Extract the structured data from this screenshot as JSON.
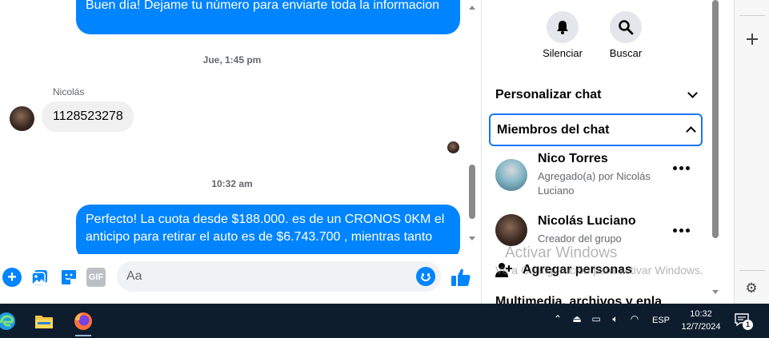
{
  "chat": {
    "messages": [
      {
        "text": "Buen día! Dejame tu número para enviarte toda la informacion",
        "direction": "outgoing"
      },
      {
        "sender": "Nicolás",
        "text": "1128523278",
        "direction": "incoming"
      },
      {
        "text": "Perfecto! La cuota desde $188.000. es de un CRONOS 0KM el anticipo para retirar el auto es de $6.743.700 , mientras tanto",
        "direction": "outgoing"
      }
    ],
    "timestamps": [
      "Jue, 1:45 pm",
      "10:32 am"
    ]
  },
  "composer": {
    "placeholder": "Aa",
    "gif_label": "GIF",
    "accent_color": "#0084ff"
  },
  "details": {
    "mute_label": "Silenciar",
    "search_label": "Buscar",
    "customize_chat": "Personalizar chat",
    "chat_members": "Miembros del chat",
    "members": [
      {
        "name": "Nico Torres",
        "subtitle": "Agregado(a) por Nicolás Luciano"
      },
      {
        "name": "Nicolás Luciano",
        "subtitle": "Creador del grupo"
      }
    ],
    "add_people": "Agregar personas",
    "media_files": "Multimedia, archivos y enla"
  },
  "watermark": {
    "title": "Activar Windows",
    "subtitle": "Ve a Configuración para activar Windows."
  },
  "taskbar": {
    "language": "ESP",
    "time": "10:32",
    "date": "12/7/2024",
    "notification_count": "1",
    "background_color": "#0d1d2e"
  }
}
